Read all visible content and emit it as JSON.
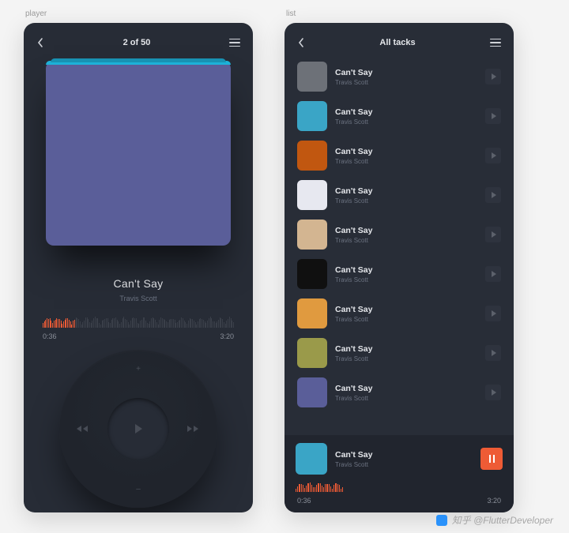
{
  "labels": {
    "player": "player",
    "list": "list"
  },
  "player": {
    "header_title": "2 of 50",
    "track_title": "Can't  Say",
    "track_artist": "Travis Scott",
    "elapsed": "0:36",
    "duration": "3:20",
    "wheel": {
      "top": "+",
      "bottom": "–"
    }
  },
  "list": {
    "header_title": "All tacks",
    "tracks": [
      {
        "title": "Can't  Say",
        "artist": "Travis Scott",
        "color": "#6d7178"
      },
      {
        "title": "Can't  Say",
        "artist": "Travis Scott",
        "color": "#3aa5c6"
      },
      {
        "title": "Can't  Say",
        "artist": "Travis Scott",
        "color": "#c15710"
      },
      {
        "title": "Can't  Say",
        "artist": "Travis Scott",
        "color": "#e7e8f0"
      },
      {
        "title": "Can't  Say",
        "artist": "Travis Scott",
        "color": "#d3b591"
      },
      {
        "title": "Can't  Say",
        "artist": "Travis Scott",
        "color": "#101010"
      },
      {
        "title": "Can't  Say",
        "artist": "Travis Scott",
        "color": "#e09a3f"
      },
      {
        "title": "Can't  Say",
        "artist": "Travis Scott",
        "color": "#9a9a4a"
      },
      {
        "title": "Can't  Say",
        "artist": "Travis Scott",
        "color": "#5a5e99"
      }
    ],
    "now_playing": {
      "title": "Can't  Say",
      "artist": "Travis Scott",
      "color": "#3aa5c6",
      "elapsed": "0:36",
      "duration": "3:20"
    }
  },
  "watermark": "知乎 @FlutterDeveloper"
}
